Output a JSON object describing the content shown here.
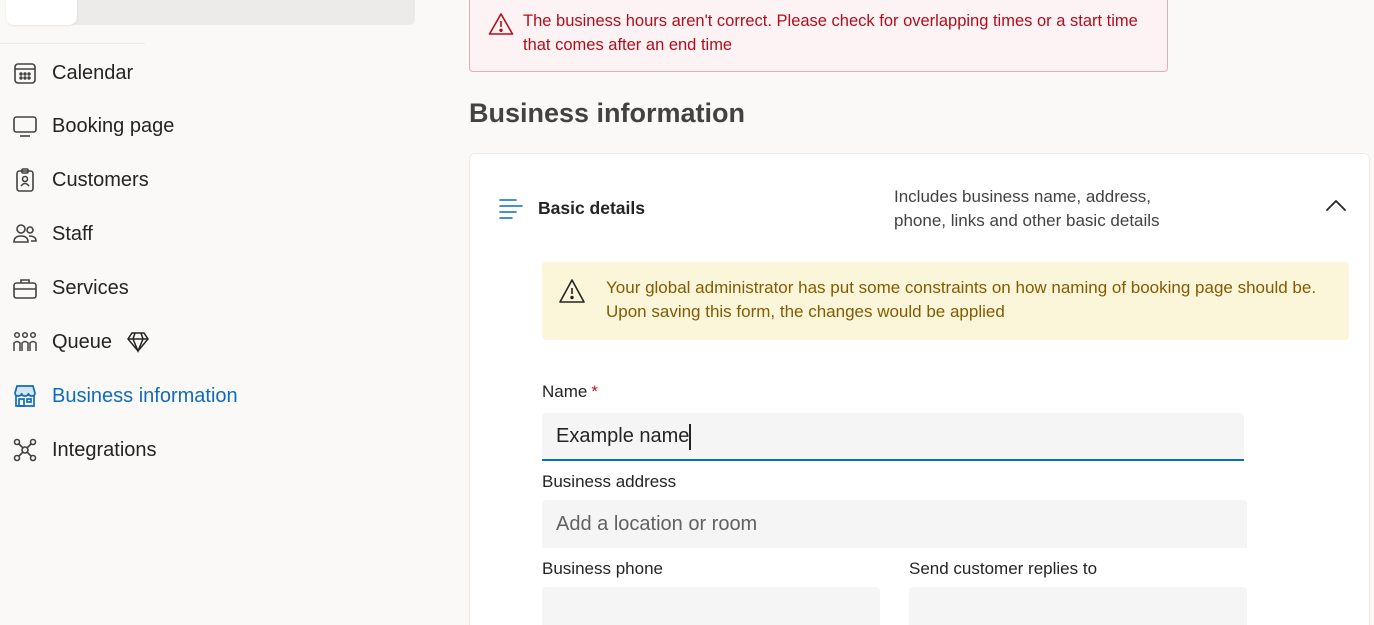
{
  "sidebar": {
    "items": [
      {
        "label": "Calendar",
        "icon": "calendar-icon"
      },
      {
        "label": "Booking page",
        "icon": "monitor-icon"
      },
      {
        "label": "Customers",
        "icon": "contact-card-icon"
      },
      {
        "label": "Staff",
        "icon": "people-icon"
      },
      {
        "label": "Services",
        "icon": "briefcase-icon"
      },
      {
        "label": "Queue",
        "icon": "people-queue-icon",
        "badge_icon": "premium-diamond-icon"
      },
      {
        "label": "Business information",
        "icon": "storefront-icon",
        "active": true
      },
      {
        "label": "Integrations",
        "icon": "network-icon"
      }
    ]
  },
  "error": {
    "icon": "warning-icon",
    "text": "The business hours aren't correct. Please check for overlapping times or a start time that comes after an end time"
  },
  "main": {
    "title": "Business information",
    "card": {
      "icon": "text-align-icon",
      "title": "Basic details",
      "description": "Includes business name, address, phone, links and other basic details",
      "collapse_icon": "chevron-up-icon",
      "warning": {
        "icon": "warning-icon",
        "text": "Your global administrator has put some constraints on how naming of booking page should be. Upon saving this form, the changes would be applied"
      },
      "fields": {
        "name": {
          "label": "Name",
          "required_mark": "*",
          "value": "Example name"
        },
        "address": {
          "label": "Business address",
          "value": "",
          "placeholder": "Add a location or room"
        },
        "phone": {
          "label": "Business phone",
          "value": ""
        },
        "replies": {
          "label": "Send customer replies to",
          "value": ""
        }
      }
    }
  },
  "colors": {
    "accent": "#0f6cbd",
    "error_text": "#b10e1c",
    "error_bg": "#fdf3f4",
    "warning_text": "#835b00",
    "warning_bg": "#fbf6d9"
  }
}
